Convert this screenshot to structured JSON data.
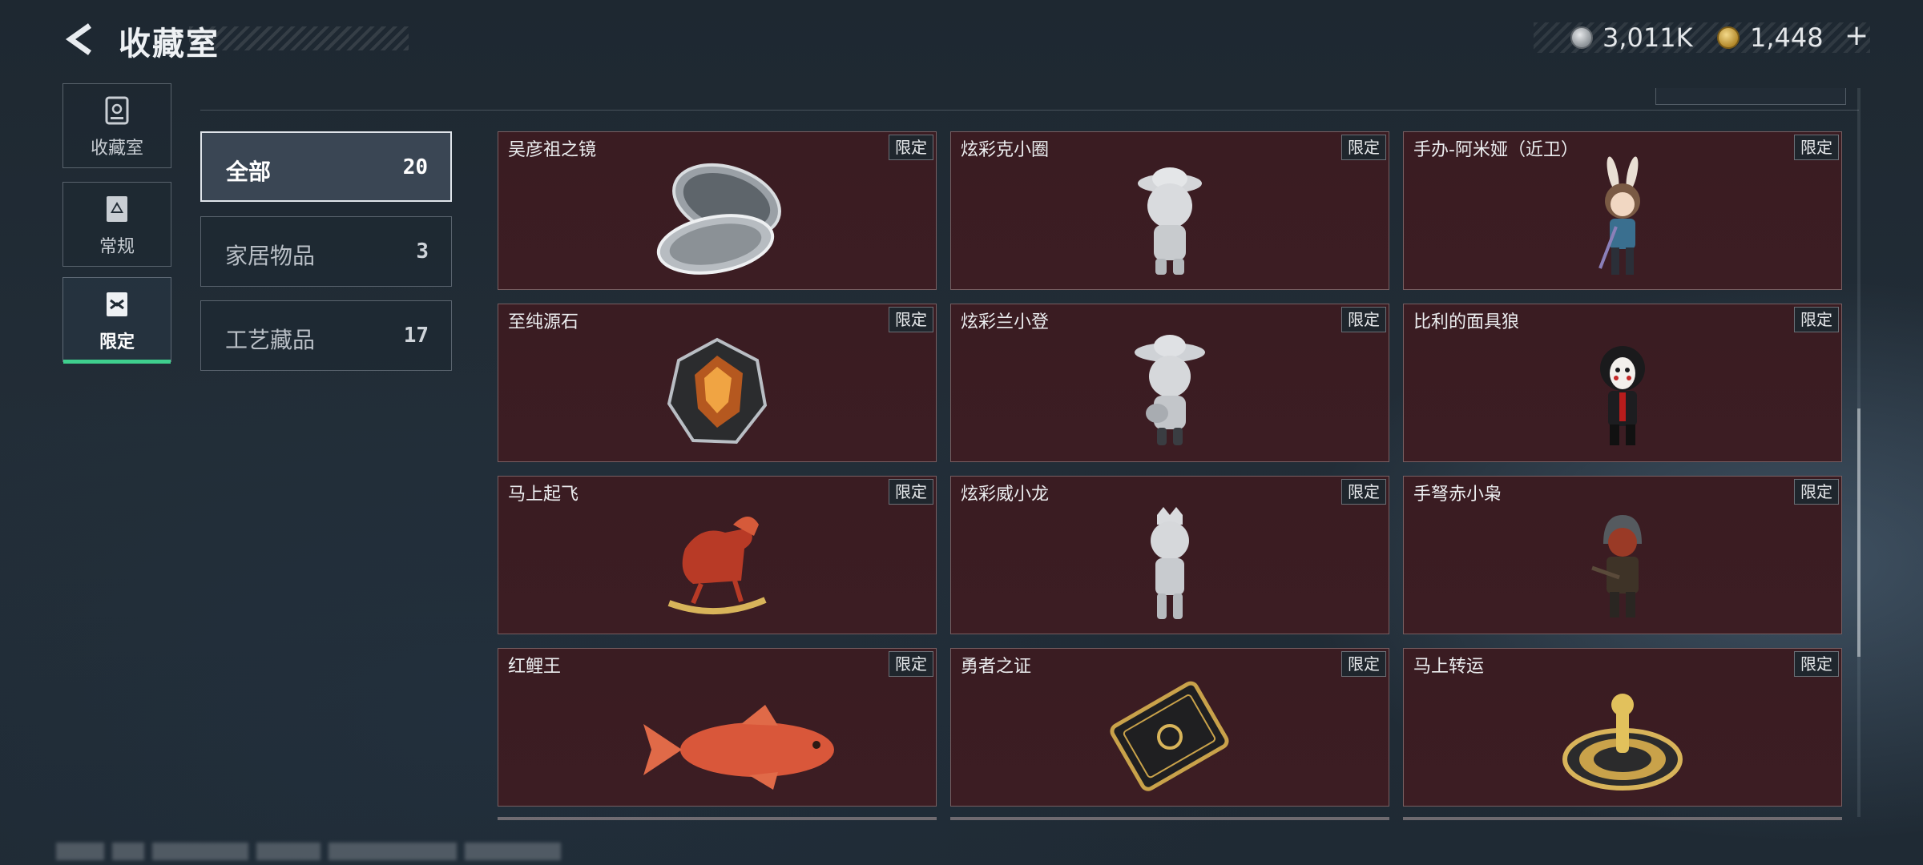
{
  "header": {
    "title": "收藏室",
    "currency": [
      {
        "icon": "silver-coin-icon",
        "value": "3,011K"
      },
      {
        "icon": "gold-coin-icon",
        "value": "1,448",
        "action": "+"
      }
    ]
  },
  "side_nav": [
    {
      "label": "收藏室",
      "icon": "collection-icon",
      "active": false
    },
    {
      "label": "常规",
      "icon": "regular-icon",
      "active": false
    },
    {
      "label": "限定",
      "icon": "limited-icon",
      "active": true
    }
  ],
  "categories": [
    {
      "name": "全部",
      "count": "20",
      "active": true
    },
    {
      "name": "家居物品",
      "count": "3",
      "active": false
    },
    {
      "name": "工艺藏品",
      "count": "17",
      "active": false
    }
  ],
  "items": [
    {
      "name": "吴彦祖之镜",
      "tag": "限定",
      "icon": "compact-mirror-icon"
    },
    {
      "name": "炫彩克小圈",
      "tag": "限定",
      "icon": "figurine-hat-icon"
    },
    {
      "name": "手办-阿米娅（近卫）",
      "tag": "限定",
      "icon": "figurine-bunny-icon"
    },
    {
      "name": "至纯源石",
      "tag": "限定",
      "icon": "crystal-gem-icon"
    },
    {
      "name": "炫彩兰小登",
      "tag": "限定",
      "icon": "figurine-sombrero-icon"
    },
    {
      "name": "比利的面具狼",
      "tag": "限定",
      "icon": "puppet-figure-icon"
    },
    {
      "name": "马上起飞",
      "tag": "限定",
      "icon": "rocking-horse-icon"
    },
    {
      "name": "炫彩威小龙",
      "tag": "限定",
      "icon": "figurine-crown-icon"
    },
    {
      "name": "手弩赤小枭",
      "tag": "限定",
      "icon": "figurine-hooded-icon"
    },
    {
      "name": "红鲤王",
      "tag": "限定",
      "icon": "koi-fish-icon"
    },
    {
      "name": "勇者之证",
      "tag": "限定",
      "icon": "badge-card-icon"
    },
    {
      "name": "马上转运",
      "tag": "限定",
      "icon": "fortune-wheel-icon"
    }
  ]
}
